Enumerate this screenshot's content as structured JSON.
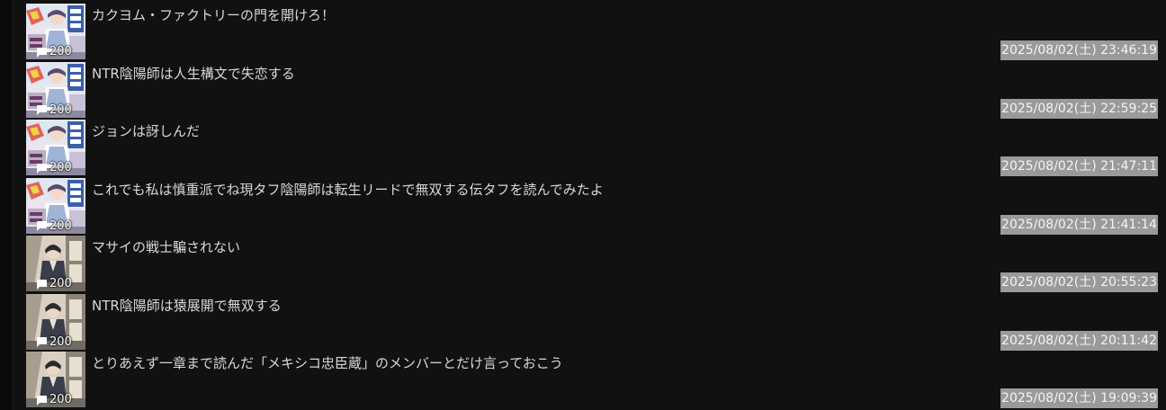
{
  "threads": [
    {
      "title": "カクヨム・ファクトリーの門を開けろ！",
      "count": "200",
      "timestamp": "2025/08/02(土) 23:46:19",
      "thumbnail": "light-novel-cover-onmyoji"
    },
    {
      "title": "NTR陰陽師は人生構文で失恋する",
      "count": "200",
      "timestamp": "2025/08/02(土) 22:59:25",
      "thumbnail": "light-novel-cover-onmyoji"
    },
    {
      "title": "ジョンは訝しんだ",
      "count": "200",
      "timestamp": "2025/08/02(土) 21:47:11",
      "thumbnail": "light-novel-cover-onmyoji"
    },
    {
      "title": "これでも私は慎重派でね現タフ陰陽師は転生リードで無双する伝タフを読んでみたよ",
      "count": "200",
      "timestamp": "2025/08/02(土) 21:41:14",
      "thumbnail": "light-novel-cover-onmyoji"
    },
    {
      "title": "マサイの戦士騙されない",
      "count": "200",
      "timestamp": "2025/08/02(土) 20:55:23",
      "thumbnail": "manga-panel-thumbnail"
    },
    {
      "title": "NTR陰陽師は猿展開で無双する",
      "count": "200",
      "timestamp": "2025/08/02(土) 20:11:42",
      "thumbnail": "manga-panel-thumbnail"
    },
    {
      "title": "とりあえず一章まで読んだ「メキシコ忠臣蔵」のメンバーとだけ言っておこう",
      "count": "200",
      "timestamp": "2025/08/02(土) 19:09:39",
      "thumbnail": "manga-panel-thumbnail"
    }
  ],
  "colors": {
    "background": "#111111",
    "title_text": "#d8d8d8",
    "timestamp_bg": "#9a9a9a",
    "timestamp_text": "#f4f4f4",
    "badge_text": "#ffffff"
  }
}
